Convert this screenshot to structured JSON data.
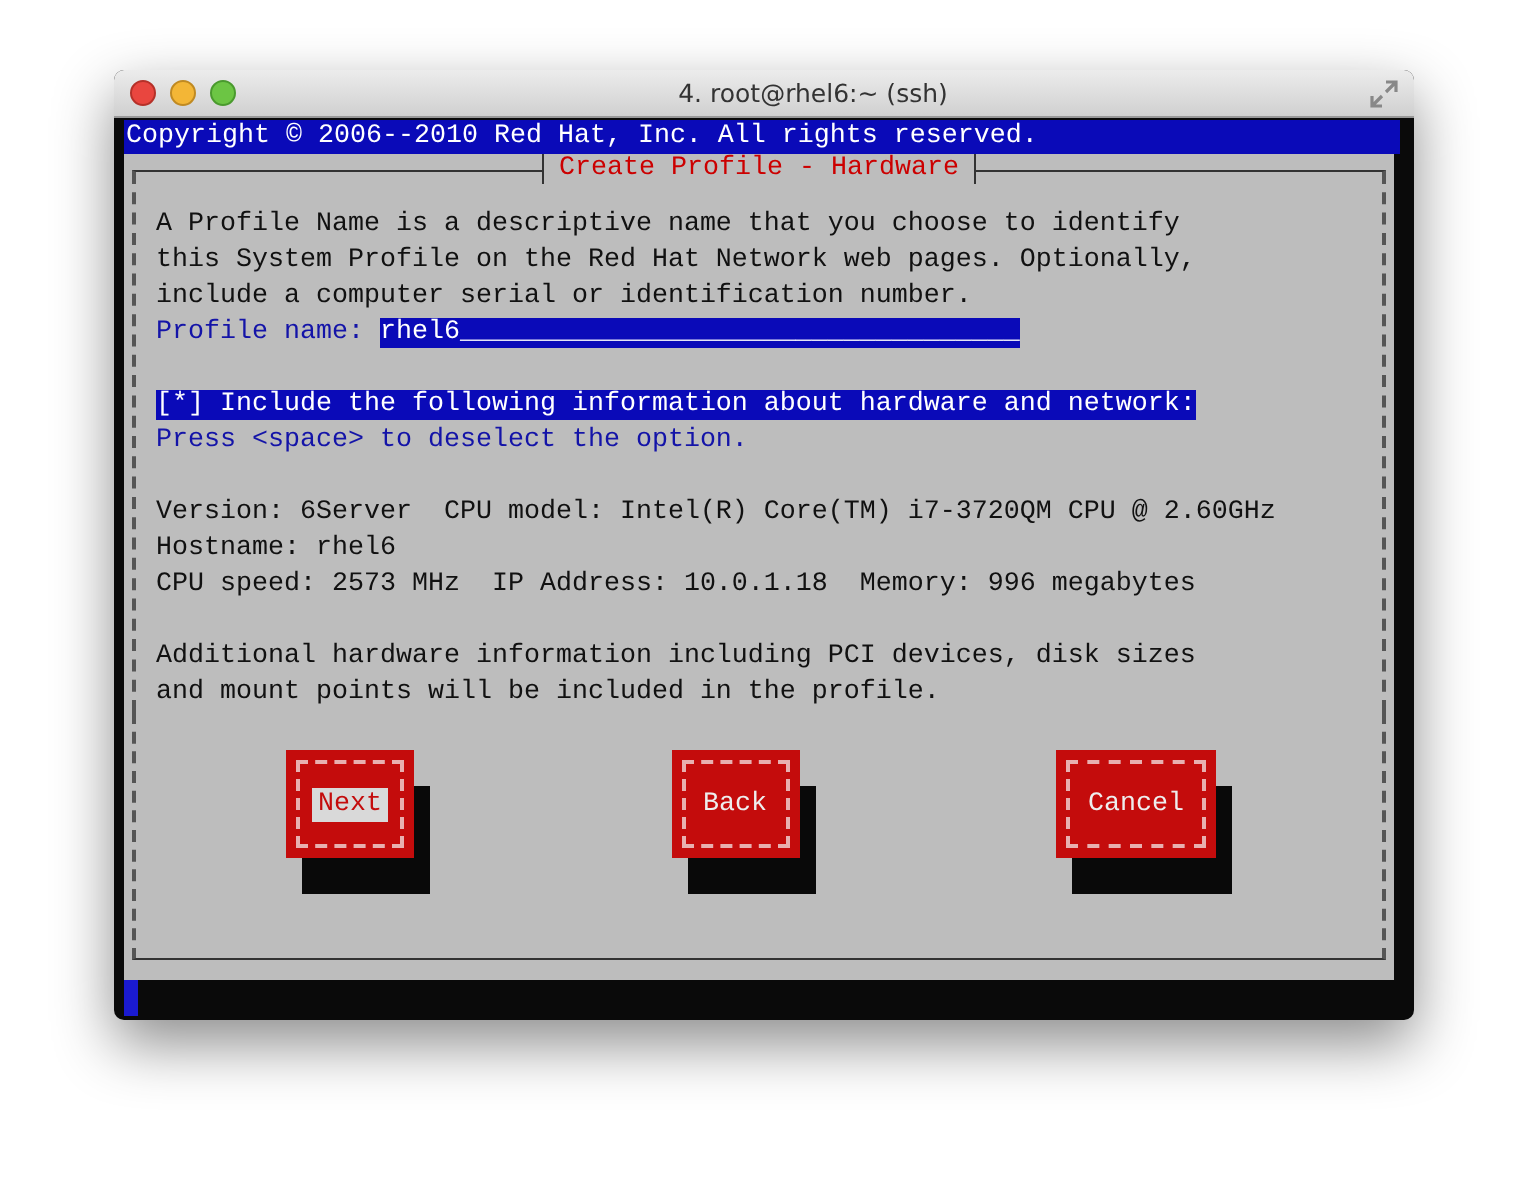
{
  "window": {
    "title": "4. root@rhel6:~ (ssh)"
  },
  "header": "Copyright © 2006--2010 Red Hat, Inc. All rights reserved.",
  "dialog": {
    "title": "Create Profile - Hardware",
    "intro": [
      "A Profile Name is a descriptive name that you choose to identify",
      "this System Profile on the Red Hat Network web pages. Optionally,",
      "include a computer serial or identification number."
    ],
    "profile_field": {
      "label": "Profile name:",
      "value": "rhel6___________________________________"
    },
    "option": {
      "label": "[*] Include the following information about hardware and network:",
      "focused": true
    },
    "hint": "Press <space> to deselect the option.",
    "info": [
      "Version: 6Server  CPU model: Intel(R) Core(TM) i7-3720QM CPU @ 2.60GHz",
      "Hostname: rhel6",
      "CPU speed: 2573 MHz  IP Address: 10.0.1.18  Memory: 996 megabytes"
    ],
    "note": [
      "Additional hardware information including PCI devices, disk sizes",
      "and mount points will be included in the profile."
    ],
    "buttons": [
      {
        "label": "Next",
        "focused": true
      },
      {
        "label": "Back",
        "focused": false
      },
      {
        "label": "Cancel",
        "focused": false
      }
    ]
  }
}
